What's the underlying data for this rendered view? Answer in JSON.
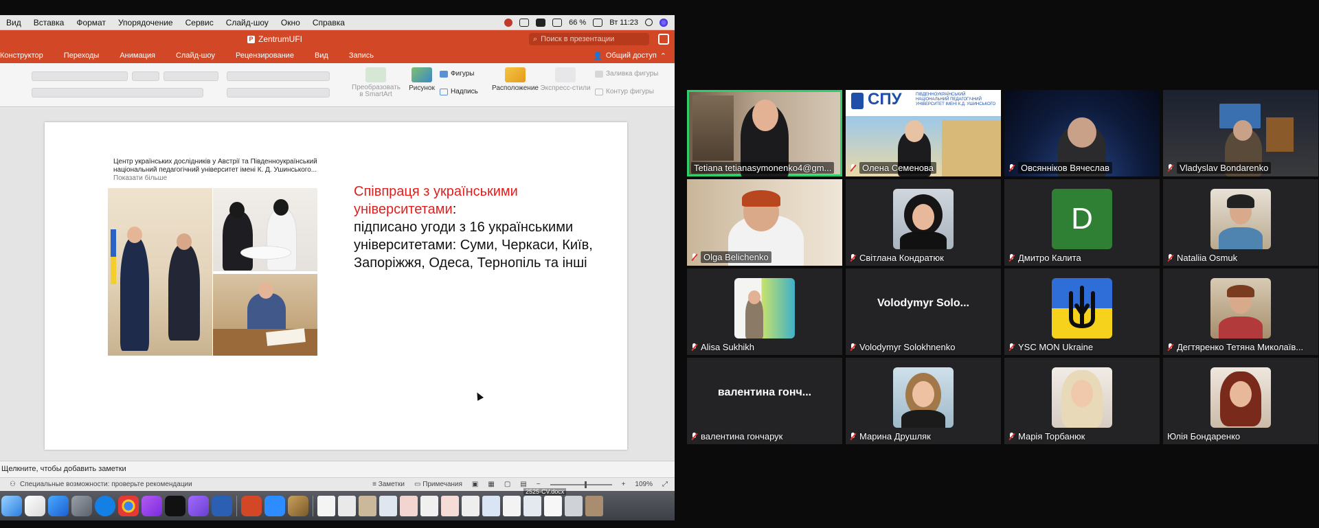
{
  "menubar": {
    "items": [
      "Вид",
      "Вставка",
      "Формат",
      "Упорядочение",
      "Сервис",
      "Слайд-шоу",
      "Окно",
      "Справка"
    ],
    "battery": "66 %",
    "time": "Вт 11:23"
  },
  "window": {
    "doc_title": "ZentrumUFI",
    "search_placeholder": "Поиск в презентации",
    "share_label": "Общий доступ"
  },
  "ribbon": {
    "tabs": [
      "Конструктор",
      "Переходы",
      "Анимация",
      "Слайд-шоу",
      "Рецензирование",
      "Вид",
      "Запись"
    ],
    "smartart_label": "Преобразовать в SmartArt",
    "picture_label": "Рисунок",
    "shapes_label": "Фигуры",
    "textbox_label": "Надпись",
    "arrange_label": "Расположение",
    "quick_styles_label": "Экспресс-стили",
    "shape_fill_label": "Заливка фигуры",
    "shape_outline_label": "Контур фигуры"
  },
  "slide": {
    "caption": "Центр українських дослідників у Австрії та Південноукраїнський національний педагогічний університет імені К. Д. Ушинського...",
    "caption_more": "Показати більше",
    "heading_red": "Співпраця з українськими університетами",
    "heading_colon": ":",
    "body": "підписано угоди з 16 українськими університетами: Суми, Черкаси, Київ, Запоріжжя, Одеса, Тернопіль та інші"
  },
  "notes": {
    "placeholder": "Щелкните, чтобы добавить заметки"
  },
  "statusbar": {
    "accessibility": "Специальные возможности: проверьте рекомендации",
    "notes_btn": "Заметки",
    "comments_btn": "Примечания",
    "zoom": "109%"
  },
  "dock": {
    "file_label": "2525-CV.docx"
  },
  "gallery": {
    "tiles": [
      {
        "name": "Tetiana tetianasymonenko4@gm...",
        "muted": false,
        "active": true
      },
      {
        "name": "Олена Семенова",
        "muted": true,
        "active": false,
        "logo_text": "СПУ",
        "logo_sub": "ПІВДЕННОУКРАЇНСЬКИЙ НАЦІОНАЛЬНИЙ ПЕДАГОГІЧНИЙ УНІВЕРСИТЕТ ІМЕНІ К.Д. УШИНСЬКОГО"
      },
      {
        "name": "Овсянніков Вячеслав",
        "muted": true
      },
      {
        "name": "Vladyslav Bondarenko",
        "muted": true
      },
      {
        "name": "Olga Belichenko",
        "muted": true
      },
      {
        "name": "Світлана Кондратюк",
        "muted": true
      },
      {
        "name": "Дмитро Калита",
        "muted": true,
        "letter": "D"
      },
      {
        "name": "Nataliia Osmuk",
        "muted": true
      },
      {
        "name": "Alisa Sukhikh",
        "muted": true
      },
      {
        "name": "Volodymyr Solokhnenko",
        "muted": true,
        "big_name": "Volodymyr Solo..."
      },
      {
        "name": "YSC MON Ukraine",
        "muted": true
      },
      {
        "name": "Дегтяренко Тетяна Миколаїв...",
        "muted": true
      },
      {
        "name": "валентина гончарук",
        "muted": true,
        "big_name": "валентина гонч..."
      },
      {
        "name": "Марина Друшляк",
        "muted": true
      },
      {
        "name": "Марія Торбанюк",
        "muted": true
      },
      {
        "name": "Юлія Бондаренко",
        "muted": false
      }
    ]
  },
  "colors": {
    "ppt_orange": "#d24726",
    "active_speaker": "#2fcf6a",
    "accent_red_text": "#e01e1e",
    "zoom_tile": "#232325"
  }
}
